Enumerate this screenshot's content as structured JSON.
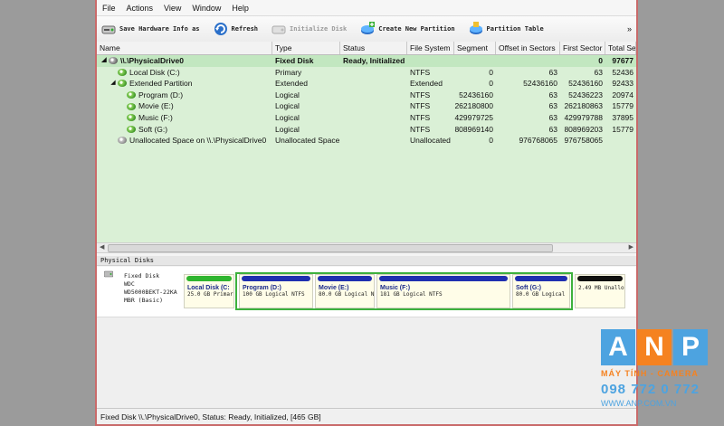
{
  "menu": [
    "File",
    "Actions",
    "View",
    "Window",
    "Help"
  ],
  "toolbar": {
    "buttons": [
      {
        "label": "Save Hardware Info as",
        "icon": "save-hardware-icon"
      },
      {
        "label": "Refresh",
        "icon": "refresh-icon"
      },
      {
        "label": "Initialize Disk",
        "icon": "initialize-disk-icon"
      },
      {
        "label": "Create New Partition",
        "icon": "create-partition-icon"
      },
      {
        "label": "Partition Table",
        "icon": "partition-table-icon"
      }
    ],
    "overflow": "»"
  },
  "table": {
    "columns": [
      "Name",
      "Type",
      "Status",
      "File System",
      "Segment",
      "Offset in Sectors",
      "First Sector",
      "Total Se"
    ],
    "rows": [
      {
        "name": "\\\\.\\PhysicalDrive0",
        "type": "Fixed Disk",
        "status": "Ready, Initialized",
        "fs": "",
        "seg": "",
        "off": "",
        "first": "0",
        "total": "97677"
      },
      {
        "name": "Local Disk (C:)",
        "type": "Primary",
        "status": "",
        "fs": "NTFS",
        "seg": "0",
        "off": "63",
        "first": "63",
        "total": "52436"
      },
      {
        "name": "Extended Partition",
        "type": "Extended",
        "status": "",
        "fs": "Extended",
        "seg": "0",
        "off": "52436160",
        "first": "52436160",
        "total": "92433"
      },
      {
        "name": "Program (D:)",
        "type": "Logical",
        "status": "",
        "fs": "NTFS",
        "seg": "52436160",
        "off": "63",
        "first": "52436223",
        "total": "20974"
      },
      {
        "name": "Movie (E:)",
        "type": "Logical",
        "status": "",
        "fs": "NTFS",
        "seg": "262180800",
        "off": "63",
        "first": "262180863",
        "total": "15779"
      },
      {
        "name": "Music (F:)",
        "type": "Logical",
        "status": "",
        "fs": "NTFS",
        "seg": "429979725",
        "off": "63",
        "first": "429979788",
        "total": "37895"
      },
      {
        "name": "Soft (G:)",
        "type": "Logical",
        "status": "",
        "fs": "NTFS",
        "seg": "808969140",
        "off": "63",
        "first": "808969203",
        "total": "15779"
      },
      {
        "name": "Unallocated Space on \\\\.\\PhysicalDrive0",
        "type": "Unallocated Space",
        "status": "",
        "fs": "Unallocated",
        "seg": "0",
        "off": "976768065",
        "first": "976758065",
        "total": ""
      }
    ]
  },
  "disk_pane": {
    "title": "Physical Disks",
    "disk_info": [
      "Fixed Disk",
      "WDC",
      "WD5000BEKT-22KA",
      "MBR (Basic)"
    ],
    "partitions": [
      {
        "name": "Local Disk (C:",
        "desc": "25.0 GB Primar",
        "color": "#2fb52f"
      },
      {
        "name": "Program (D:)",
        "desc": "100 GB Logical NTFS",
        "color": "#1f2fb0"
      },
      {
        "name": "Movie (E:)",
        "desc": "80.0 GB Logical NTFS",
        "color": "#1f2fb0"
      },
      {
        "name": "Music (F:)",
        "desc": "181 GB Logical NTFS",
        "color": "#1f2fb0"
      },
      {
        "name": "Soft (G:)",
        "desc": "80.0 GB Logical",
        "color": "#1f2fb0"
      },
      {
        "name": "",
        "desc": "2.49 MB Unallo",
        "color": "#111111"
      }
    ]
  },
  "status_bar": "Fixed Disk \\\\.\\PhysicalDrive0, Status: Ready, Initialized, [465 GB]",
  "watermark": {
    "letters": [
      "A",
      "N",
      "P"
    ],
    "letter_colors": [
      "#4da3e0",
      "#f58220",
      "#4da3e0"
    ],
    "tagline": "MÁY TÍNH - CAMERA",
    "phone": "098 772 0 772",
    "website": "WWW.ANP.COM.VN"
  }
}
